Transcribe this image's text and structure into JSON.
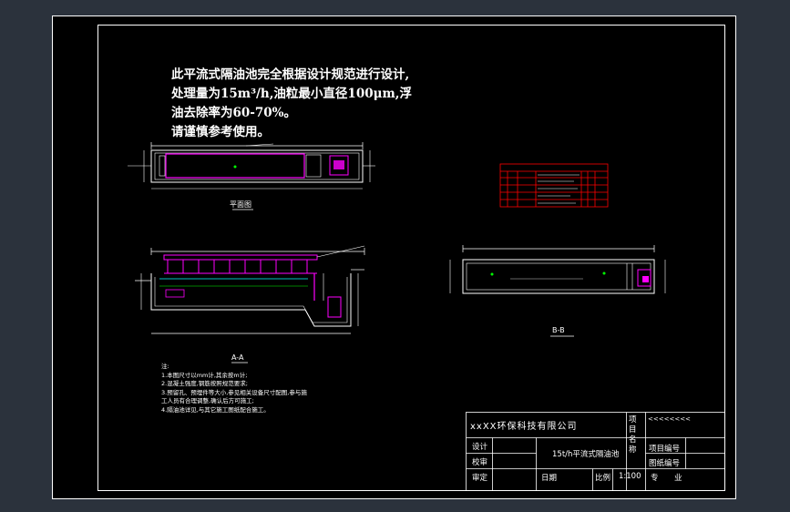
{
  "design_notes": [
    "此平流式隔油池完全根据设计规范进行设计,",
    "处理量为15m³/h,油粒最小直径100μm,浮",
    "油去除率为60-70%。",
    "请谨慎参考使用。"
  ],
  "view_labels": {
    "plan": "平面图",
    "section_aa": "A-A",
    "section_bb": "B-B"
  },
  "notes_block": {
    "title": "注:",
    "items": [
      "1.本图尺寸以mm计,其余按m计;",
      "2.混凝土强度,钢筋按照规范要求;",
      "3.预留孔、预埋件等大小,参见相关设备尺寸配图,参与施",
      "  工人员有合理调整,确认后方可施工;",
      "4.隔油池详见,与其它施工图纸配合施工。"
    ]
  },
  "title_block": {
    "company": "xxXX环保科技有限公司",
    "project_name_label": "项目名称",
    "project_name_value": "<<<<<<<<",
    "design_label": "设计",
    "review_label": "校审",
    "approve_label": "审定",
    "drawing_title": "15t/h平流式隔油池",
    "date_label": "日期",
    "scale_label": "比例",
    "scale_value": "1:100",
    "project_no_label": "项目编号",
    "drawing_no_label": "图纸编号",
    "discipline_label": "专",
    "discipline_label_2": "业"
  },
  "colors": {
    "background": "#2b323c",
    "sheet": "#000000",
    "line": "#ffffff",
    "magenta": "#ff00ff",
    "green": "#00ff00",
    "cyan": "#00ffff",
    "red": "#ff0000"
  }
}
